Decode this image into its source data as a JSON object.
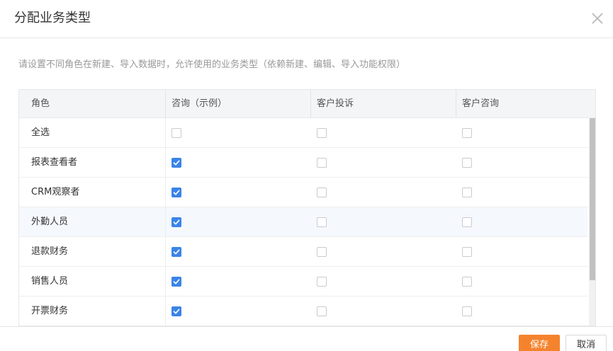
{
  "dialog": {
    "title": "分配业务类型",
    "description": "请设置不同角色在新建、导入数据时，允许使用的业务类型（依赖新建、编辑、导入功能权限）"
  },
  "table": {
    "columns": [
      "角色",
      "咨询（示例）",
      "客户投诉",
      "客户咨询"
    ],
    "rows": [
      {
        "role": "全选",
        "checks": [
          false,
          false,
          false
        ]
      },
      {
        "role": "报表查看者",
        "checks": [
          true,
          false,
          false
        ]
      },
      {
        "role": "CRM观察者",
        "checks": [
          true,
          false,
          false
        ]
      },
      {
        "role": "外勤人员",
        "checks": [
          true,
          false,
          false
        ],
        "highlighted": true
      },
      {
        "role": "退款财务",
        "checks": [
          true,
          false,
          false
        ]
      },
      {
        "role": "销售人员",
        "checks": [
          true,
          false,
          false
        ]
      },
      {
        "role": "开票财务",
        "checks": [
          true,
          false,
          false
        ]
      }
    ]
  },
  "footer": {
    "save_label": "保存",
    "cancel_label": "取消"
  },
  "colors": {
    "accent": "#f5832d",
    "checkbox_checked": "#3a84e8"
  },
  "icons": {
    "close": "close-icon",
    "check": "checkmark-icon"
  }
}
